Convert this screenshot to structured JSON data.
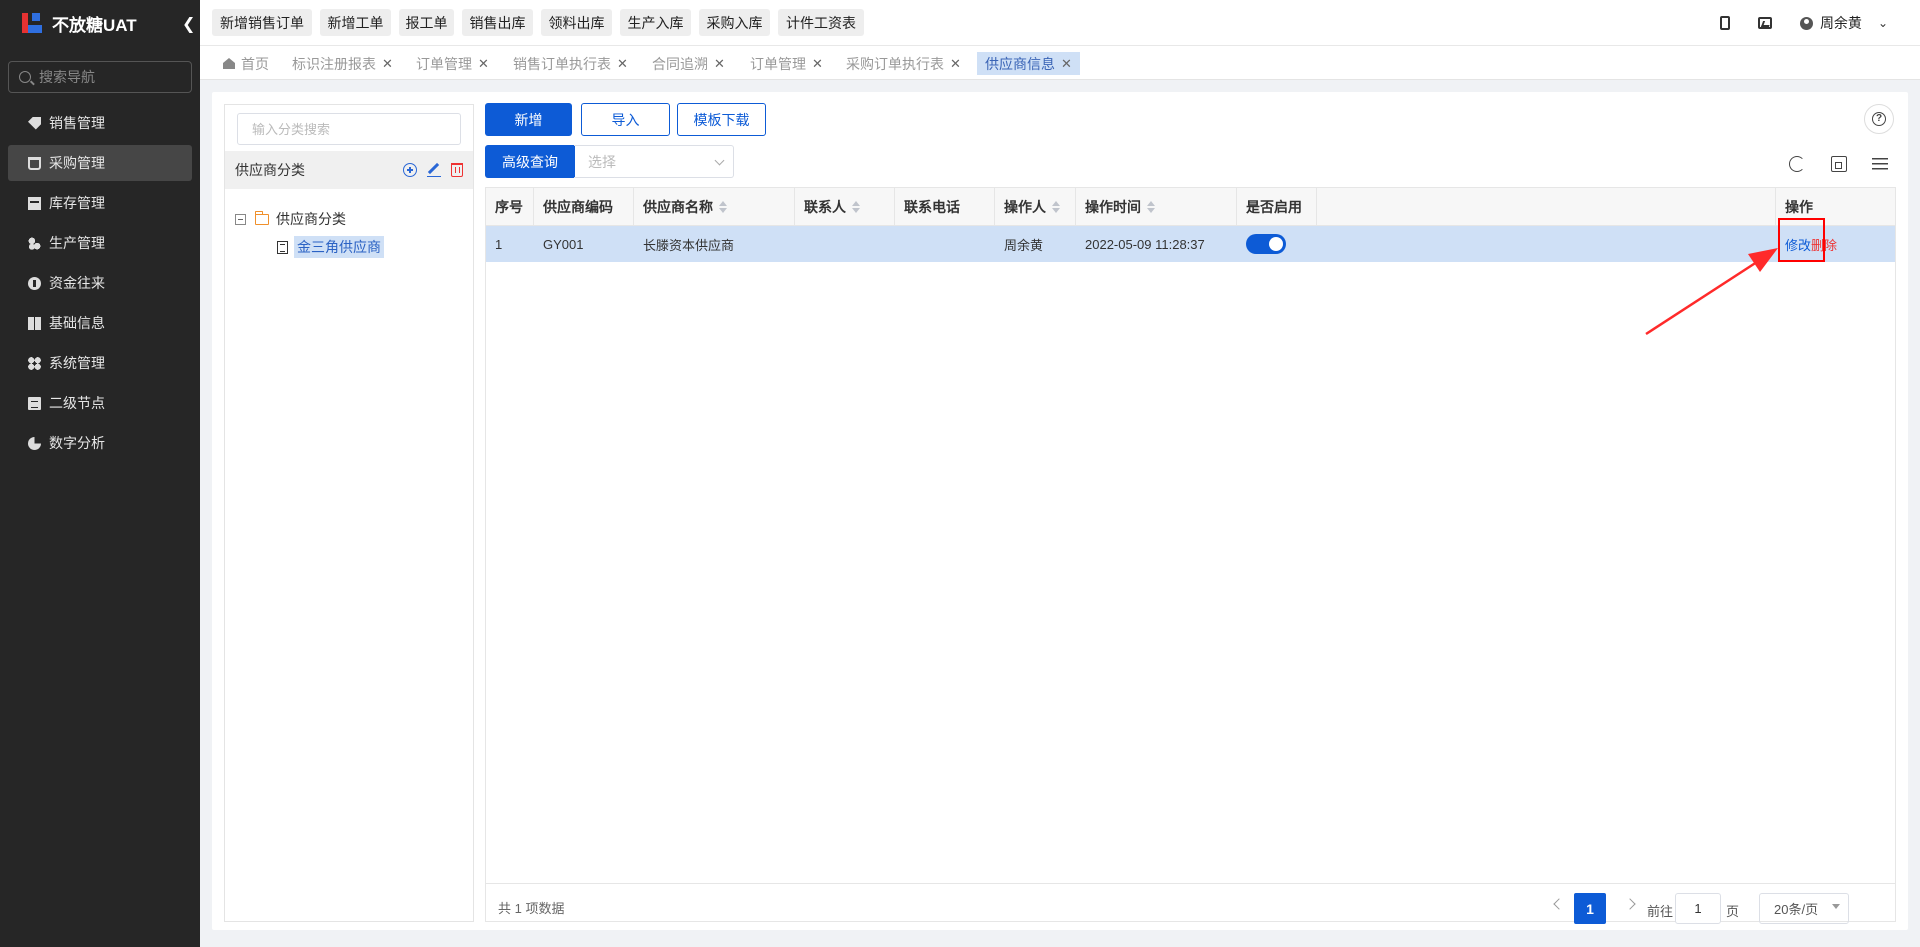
{
  "app": {
    "title": "不放糖UAT",
    "collapse_icon": "chevron-left-icon"
  },
  "sidebar": {
    "search_placeholder": "搜索导航",
    "items": [
      {
        "label": "销售管理",
        "icon": "tag-icon",
        "active": false
      },
      {
        "label": "采购管理",
        "icon": "cart-icon",
        "active": true
      },
      {
        "label": "库存管理",
        "icon": "box-icon",
        "active": false
      },
      {
        "label": "生产管理",
        "icon": "dots-icon",
        "active": false
      },
      {
        "label": "资金往来",
        "icon": "coin-icon",
        "active": false
      },
      {
        "label": "基础信息",
        "icon": "grid-icon",
        "active": false
      },
      {
        "label": "系统管理",
        "icon": "four-dots-icon",
        "active": false
      },
      {
        "label": "二级节点",
        "icon": "document-icon",
        "active": false
      },
      {
        "label": "数字分析",
        "icon": "pie-chart-icon",
        "active": false
      }
    ]
  },
  "quick_actions": [
    "新增销售订单",
    "新增工单",
    "报工单",
    "销售出库",
    "领料出库",
    "生产入库",
    "采购入库",
    "计件工资表"
  ],
  "topbar": {
    "user_name": "周余黄",
    "icons": [
      "phone-icon",
      "screen-icon",
      "user-icon"
    ]
  },
  "tabs": [
    {
      "label": "首页",
      "closable": false,
      "active": false
    },
    {
      "label": "标识注册报表",
      "closable": true,
      "active": false
    },
    {
      "label": "订单管理",
      "closable": true,
      "active": false
    },
    {
      "label": "销售订单执行表",
      "closable": true,
      "active": false
    },
    {
      "label": "合同追溯",
      "closable": true,
      "active": false
    },
    {
      "label": "订单管理",
      "closable": true,
      "active": false
    },
    {
      "label": "采购订单执行表",
      "closable": true,
      "active": false
    },
    {
      "label": "供应商信息",
      "closable": true,
      "active": true
    }
  ],
  "category": {
    "search_placeholder": "输入分类搜索",
    "header": "供应商分类",
    "tree_root": "供应商分类",
    "tree_child": "金三角供应商"
  },
  "toolbar": {
    "add_label": "新增",
    "import_label": "导入",
    "template_label": "模板下载",
    "advanced_label": "高级查询",
    "select_placeholder": "选择"
  },
  "table": {
    "columns": [
      "序号",
      "供应商编码",
      "供应商名称",
      "联系人",
      "联系电话",
      "操作人",
      "操作时间",
      "是否启用",
      "操作"
    ],
    "rows": [
      {
        "index": "1",
        "code": "GY001",
        "name": "长滕资本供应商",
        "contact": "",
        "phone": "",
        "operator": "周余黄",
        "time": "2022-05-09 11:28:37",
        "enabled": true,
        "edit": "修改",
        "delete": "删除"
      }
    ]
  },
  "pagination": {
    "total_text": "共 1 项数据",
    "current_page": "1",
    "goto_label": "前往",
    "goto_value": "1",
    "page_label": "页",
    "page_size": "20条/页"
  },
  "colors": {
    "primary": "#0d5bd6",
    "danger": "#ee3333",
    "sidebar_bg": "#262626",
    "selected_row": "#cfe0f6",
    "annotation": "#ff0000"
  }
}
